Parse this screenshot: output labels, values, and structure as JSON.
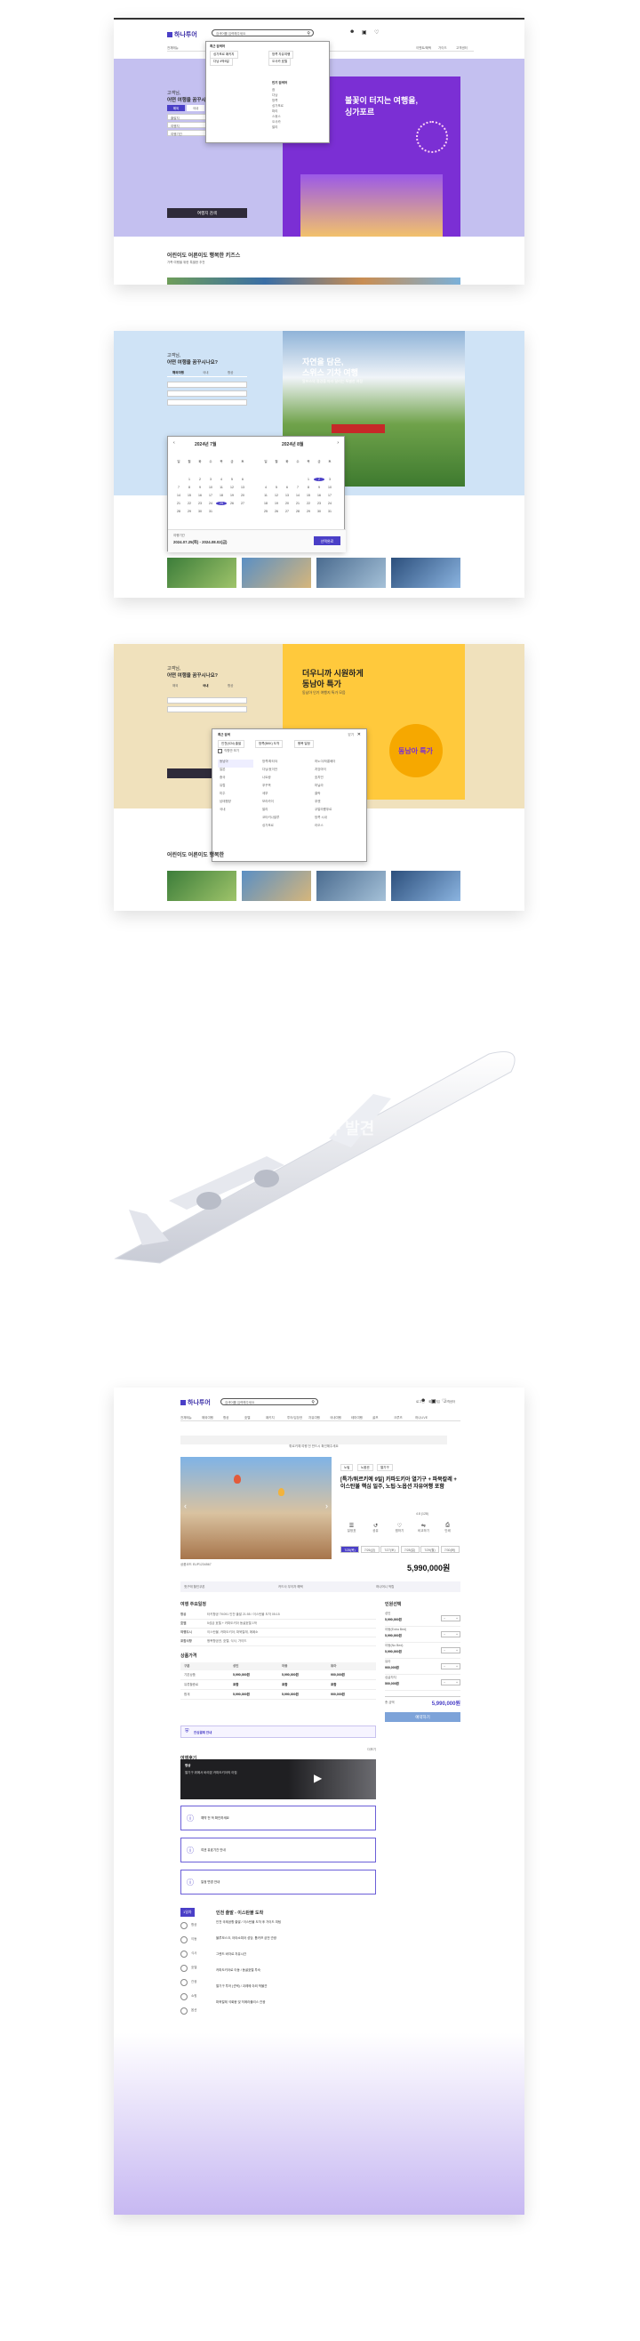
{
  "brand": {
    "name": "하나투어",
    "accent": "#4a3fc7",
    "accent_dark": "#2f2b3a"
  },
  "header": {
    "search_placeholder": "검색어를 입력해주세요",
    "util_links": [
      "로그인",
      "회원가입",
      "고객센터"
    ],
    "nav_items": [
      "전체메뉴",
      "해외여행",
      "항공",
      "호텔",
      "패키지",
      "투어/입장권",
      "자유여행",
      "국내여행",
      "테마여행",
      "골프",
      "크루즈",
      "하나LIVE"
    ],
    "right_links": [
      "이벤트/혜택",
      "가이드",
      "고객센터"
    ]
  },
  "screen1": {
    "greeting": "고객님,",
    "question": "어떤 여행을 꿈꾸시나요?",
    "tabs": [
      "해외",
      "국내"
    ],
    "fields": [
      "출발지",
      "여행지",
      "여행기간",
      "인원"
    ],
    "search_button": "여행지 검색",
    "banner_title": "불꽃이 터지는 여행을,",
    "banner_subtitle": "싱가포르",
    "dropdown_title": "최근 검색어",
    "recent_keywords": [
      "싱가포르 패키지",
      "방콕 자유여행",
      "다낭 4박5일",
      "오사카 호텔"
    ],
    "popular_title": "인기 검색어",
    "popular_keywords": [
      "괌",
      "다낭",
      "방콕",
      "싱가포르",
      "파리",
      "스위스",
      "오사카",
      "발리"
    ],
    "section_title": "어린이도 어른이도 행복한 키즈스",
    "section_subtitle": "가족 여행을 위한 특별한 추천"
  },
  "screen2": {
    "greeting": "고객님,",
    "question": "어떤 여행을 꿈꾸시나요?",
    "tabs": [
      "해외여행",
      "국내",
      "항공"
    ],
    "banner_title": "자연을 담은,",
    "banner_title2": "스위스 기차 여행",
    "banner_desc": "알프스의 절경을 따라 달리는 특별한 여정",
    "month1": "2024년 7월",
    "month2": "2024년 8월",
    "weekdays": [
      "일",
      "월",
      "화",
      "수",
      "목",
      "금",
      "토"
    ],
    "days": [
      "1",
      "2",
      "3",
      "4",
      "5",
      "6",
      "7",
      "8",
      "9",
      "10",
      "11",
      "12",
      "13",
      "14",
      "15",
      "16",
      "17",
      "18",
      "19",
      "20",
      "21",
      "22",
      "23",
      "24",
      "25",
      "26",
      "27",
      "28",
      "29",
      "30",
      "31"
    ],
    "selected_label": "여행기간",
    "selected_value": "2024.07.25(목) - 2024.08.02(금)",
    "confirm_button": "선택완료"
  },
  "screen3": {
    "greeting": "고객님,",
    "question": "어떤 여행을 꿈꾸시나요?",
    "tabs": [
      "해외",
      "국내",
      "항공"
    ],
    "banner_title": "더우니까 시원하게",
    "banner_title2": "동남아 특가",
    "banner_desc": "동남아 인기 여행지 특가 모음",
    "banner_badge": "동남아 특가",
    "panel_title": "최근 검색",
    "chips": [
      "인천(ICN) 출발",
      "방콕(BKK) 도착",
      "왕복 일정"
    ],
    "checkbox_label": "직항만 보기",
    "regions": [
      "동남아",
      "일본",
      "중국",
      "유럽",
      "미주",
      "남태평양",
      "국내"
    ],
    "cities_left": [
      "방콕/파타야",
      "다낭/호이안",
      "나트랑",
      "푸꾸옥",
      "세부",
      "보라카이",
      "발리",
      "코타키나발루",
      "싱가포르"
    ],
    "cities_right": [
      "하노이/하롱베이",
      "치앙마이",
      "호치민",
      "마닐라",
      "클락",
      "푸켓",
      "쿠알라룸푸르",
      "방콕 시내",
      "라오스"
    ],
    "section_title": "어린이도 어른이도 행복한",
    "close_label": "닫기"
  },
  "promo": {
    "overlay_text": "신규 발견"
  },
  "detail": {
    "notice_bar": "튀르키예 여행 전 반드시 확인해주세요",
    "title": "[특가/튀르키예 9일] 카파도키아 열기구 + 파묵칼레 + 이스탄불 핵심 일주, 노팁·노옵션 자유여행 포함",
    "code": "상품코드 EUP1234567",
    "badges": [
      "노팁",
      "노옵션",
      "열기구"
    ],
    "rating_text": "4.8 (128)",
    "icon_labels": [
      "일정표",
      "공유",
      "찜하기",
      "비교하기",
      "인쇄"
    ],
    "date_tabs": [
      "7/25(목)",
      "7/26(금)",
      "7/27(토)",
      "7/28(일)",
      "7/29(월)",
      "7/30(화)"
    ],
    "price_big": "5,990,000원",
    "coupon_labels": [
      "첫구매 할인쿠폰",
      "카드사 무이자 혜택",
      "하나머니 적립"
    ],
    "schedule_title": "여행 주요일정",
    "schedule_rows": [
      {
        "label": "항공",
        "value": "터키항공 TK091 인천 출발 21:55 / 이스탄불 도착 05:15"
      },
      {
        "label": "호텔",
        "value": "5성급 호텔 + 카파도키아 동굴호텔 1박"
      },
      {
        "label": "여행도시",
        "value": "이스탄불, 카파도키아, 파묵칼레, 에페소"
      },
      {
        "label": "포함사항",
        "value": "왕복항공권, 호텔, 식사, 가이드"
      }
    ],
    "fee_title": "상품가격",
    "fee_headers": [
      "구분",
      "성인",
      "아동",
      "유아"
    ],
    "fee_rows": [
      {
        "name": "기본상품",
        "adult": "5,990,000원",
        "child": "5,990,000원",
        "infant": "900,000원"
      },
      {
        "name": "유류할증료",
        "adult": "포함",
        "child": "포함",
        "infant": "포함"
      },
      {
        "name": "합계",
        "adult": "5,990,000원",
        "child": "5,990,000원",
        "infant": "900,000원"
      }
    ],
    "safe_label": "안심결제 안내",
    "reserve_title": "인원선택",
    "reserve_rows": [
      {
        "label": "성인",
        "price": "5,990,000원"
      },
      {
        "label": "아동(Extra Bed)",
        "price": "5,990,000원"
      },
      {
        "label": "아동(No Bed)",
        "price": "5,990,000원"
      },
      {
        "label": "유아",
        "price": "900,000원"
      },
      {
        "label": "싱글차지",
        "price": "500,000원"
      }
    ],
    "total_label": "총 금액",
    "total_price": "5,990,000원",
    "reserve_button": "예약하기",
    "review_title": "여행후기",
    "review_more": "더보기",
    "video_title": "영상",
    "video_desc": "열기구 위에서 바라본 카파도키아의 아침",
    "notices": [
      "예약 전 꼭 확인하세요",
      "여권 유효기간 안내",
      "일정 변경 안내"
    ],
    "day_label": "1일차",
    "day_title": "인천 출발 - 이스탄불 도착",
    "itinerary_icons": [
      "항공",
      "이동",
      "식사",
      "호텔",
      "관광",
      "쇼핑",
      "옵션"
    ],
    "itinerary_lines": [
      "인천 국제공항 출발 / 이스탄불 도착 후 가이드 미팅",
      "블루모스크, 아야소피아 성당, 톱카프 궁전 관광",
      "그랜드 바자르 자유시간",
      "카파도키아로 이동 / 동굴호텔 투숙",
      "열기구 투어 (선택) / 괴레메 야외 박물관",
      "파묵칼레 석회붕 및 히에라폴리스 관광"
    ]
  }
}
